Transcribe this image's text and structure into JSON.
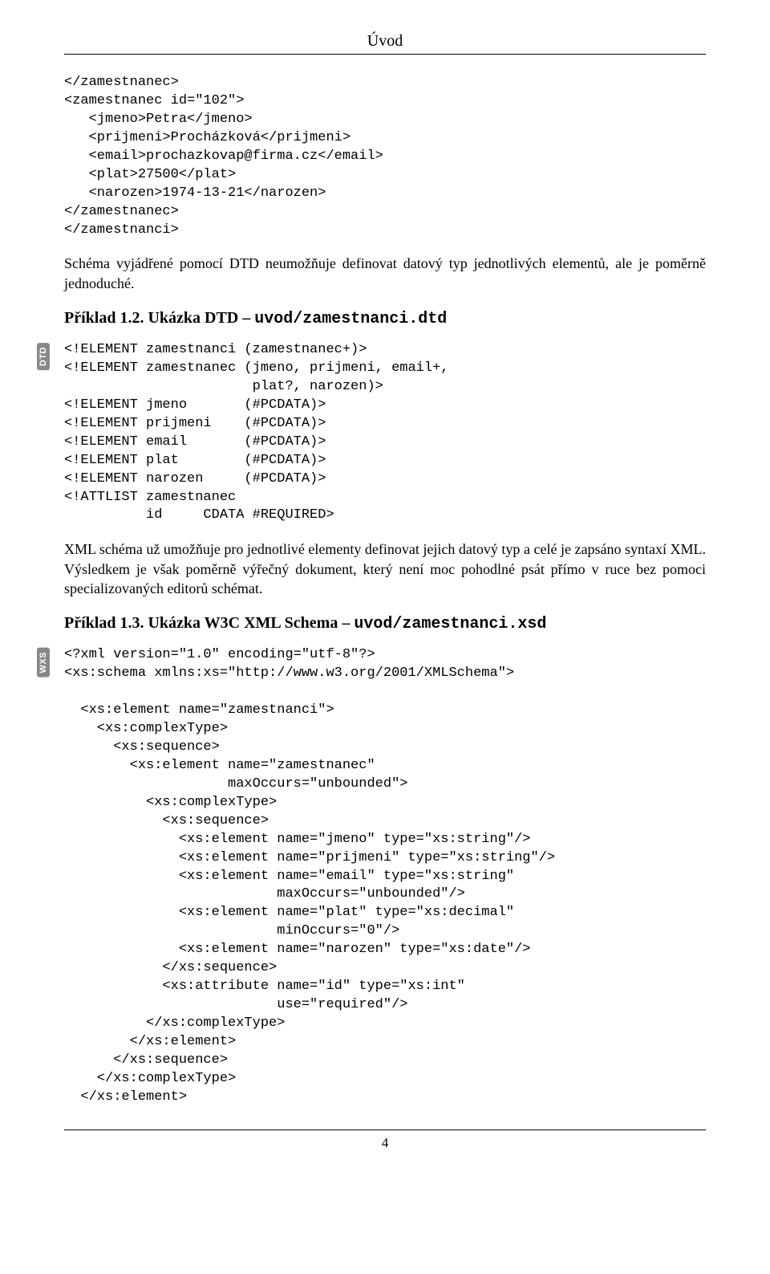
{
  "header": {
    "title": "Úvod"
  },
  "code_xml_frag": "</zamestnanec>\n<zamestnanec id=\"102\">\n   <jmeno>Petra</jmeno>\n   <prijmeni>Procházková</prijmeni>\n   <email>prochazkovap@firma.cz</email>\n   <plat>27500</plat>\n   <narozen>1974-13-21</narozen>\n</zamestnanec>\n</zamestnanci>",
  "para1": "Schéma vyjádřené pomocí DTD neumožňuje definovat datový typ jednotlivých elementů, ale je poměrně jednoduché.",
  "example12": {
    "prefix": "Příklad 1.2. Ukázka DTD – ",
    "filename": "uvod/zamestnanci.dtd"
  },
  "badge_dtd": "DTD",
  "code_dtd": "<!ELEMENT zamestnanci (zamestnanec+)>\n<!ELEMENT zamestnanec (jmeno, prijmeni, email+,\n                       plat?, narozen)>\n<!ELEMENT jmeno       (#PCDATA)>\n<!ELEMENT prijmeni    (#PCDATA)>\n<!ELEMENT email       (#PCDATA)>\n<!ELEMENT plat        (#PCDATA)>\n<!ELEMENT narozen     (#PCDATA)>\n<!ATTLIST zamestnanec\n          id     CDATA #REQUIRED>",
  "para2": "XML schéma už umožňuje pro jednotlivé elementy definovat jejich datový typ a celé je zapsáno syntaxí XML. Výsledkem je však poměrně výřečný dokument, který není moc pohodlné psát přímo v ruce bez pomoci specializovaných editorů schémat.",
  "example13": {
    "prefix": "Příklad 1.3. Ukázka W3C XML Schema – ",
    "filename": "uvod/zamestnanci.xsd"
  },
  "badge_wxs": "WXS",
  "code_xsd": "<?xml version=\"1.0\" encoding=\"utf-8\"?>\n<xs:schema xmlns:xs=\"http://www.w3.org/2001/XMLSchema\">\n\n  <xs:element name=\"zamestnanci\">\n    <xs:complexType>\n      <xs:sequence>\n        <xs:element name=\"zamestnanec\"\n                    maxOccurs=\"unbounded\">\n          <xs:complexType>\n            <xs:sequence>\n              <xs:element name=\"jmeno\" type=\"xs:string\"/>\n              <xs:element name=\"prijmeni\" type=\"xs:string\"/>\n              <xs:element name=\"email\" type=\"xs:string\"\n                          maxOccurs=\"unbounded\"/>\n              <xs:element name=\"plat\" type=\"xs:decimal\"\n                          minOccurs=\"0\"/>\n              <xs:element name=\"narozen\" type=\"xs:date\"/>\n            </xs:sequence>\n            <xs:attribute name=\"id\" type=\"xs:int\"\n                          use=\"required\"/>\n          </xs:complexType>\n        </xs:element>\n      </xs:sequence>\n    </xs:complexType>\n  </xs:element>",
  "footer": {
    "page_number": "4"
  }
}
